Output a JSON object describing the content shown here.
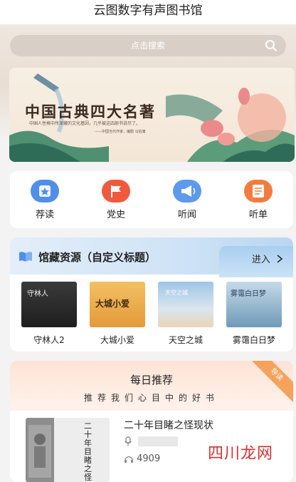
{
  "app": {
    "title": "云图数字有声图书馆"
  },
  "search": {
    "placeholder": "点击搜索"
  },
  "banner": {
    "title": "中国古典四大名著",
    "subtitle": "中国人性格中所深藏的文化基因，几乎被这四部书说尽了。",
    "author": "——中国当代作家，编剧 马伯庸"
  },
  "quick_nav": [
    {
      "label": "荐读",
      "icon": "star-icon",
      "color": "#4f8fe8"
    },
    {
      "label": "党史",
      "icon": "flag-icon",
      "color": "#ef5a3c"
    },
    {
      "label": "听闻",
      "icon": "megaphone-icon",
      "color": "#5d9aee"
    },
    {
      "label": "听单",
      "icon": "list-icon",
      "color": "#f47b3e"
    }
  ],
  "library": {
    "title": "馆藏资源（自定义标题）",
    "enter_label": "进入",
    "books": [
      {
        "title": "守林人2",
        "cover_text": "守林人"
      },
      {
        "title": "大城小爱",
        "cover_text": "大城小爱"
      },
      {
        "title": "天空之城",
        "cover_text": "天空之城"
      },
      {
        "title": "雾霭白日梦",
        "cover_text": "雾霭白日梦"
      }
    ]
  },
  "daily": {
    "title": "每日推荐",
    "slogan": "推荐我们心目中的好书",
    "ribbon": "导读",
    "book": {
      "title": "二十年目睹之怪现状",
      "cover_text": "二十年目睹之怪现状",
      "plays": "4909"
    }
  },
  "watermark": "四川龙网",
  "colors": {
    "accent_blue": "#4f8fe8",
    "accent_orange": "#f5a25c"
  }
}
